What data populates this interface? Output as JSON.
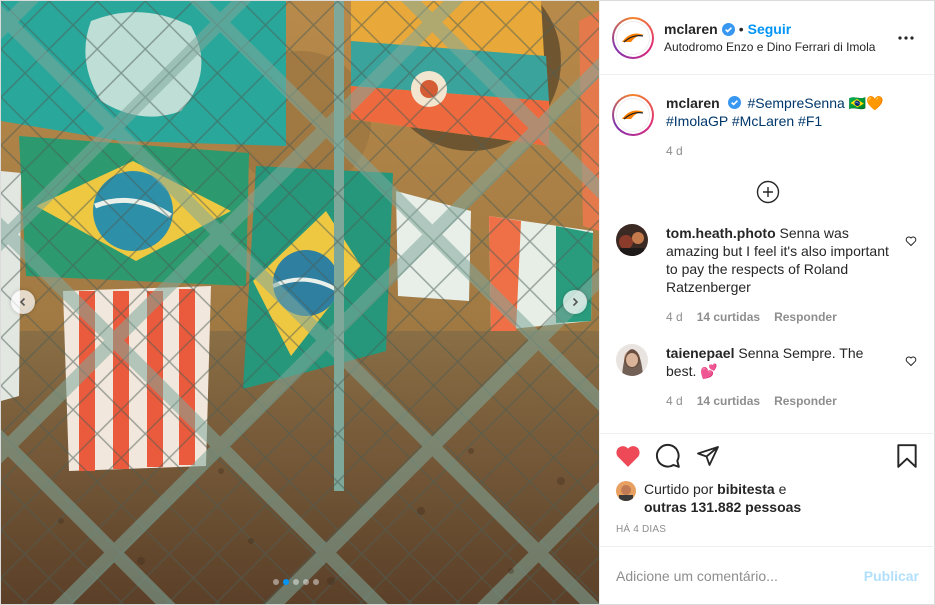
{
  "post": {
    "username": "mclaren",
    "follow_label": "Seguir",
    "separator": "•",
    "location": "Autodromo Enzo e Dino Ferrari di Imola"
  },
  "caption": {
    "username": "mclaren",
    "hashtag1": "#SempreSenna",
    "emoji": "🇧🇷🧡",
    "hashtag2": "#ImolaGP",
    "hashtag3": "#McLaren",
    "hashtag4": "#F1",
    "age": "4 d"
  },
  "comments": [
    {
      "username": "tom.heath.photo",
      "text": "Senna was amazing but I feel it's also important to pay the respects of Roland Ratzenberger",
      "age": "4 d",
      "likes": "14 curtidas",
      "reply": "Responder"
    },
    {
      "username": "taienepael",
      "text": "Senna Sempre. The best. 💕",
      "age": "4 d",
      "likes": "14 curtidas",
      "reply": "Responder"
    }
  ],
  "likes": {
    "prefix": "Curtido por",
    "user": "bibitesta",
    "and": "e",
    "others": "outras 131.882 pessoas"
  },
  "timestamp": "HÁ 4 DIAS",
  "add_comment": {
    "placeholder": "Adicione um comentário...",
    "publish_label": "Publicar"
  },
  "carousel": {
    "slide_count": 5,
    "active_slide": 2
  },
  "icons": {
    "verified": "verified-badge-icon",
    "more": "more-options-icon",
    "add_comments": "plus-circle-icon",
    "like": "heart-filled-icon",
    "comment": "comment-icon",
    "share": "share-icon",
    "save": "bookmark-icon"
  },
  "colors": {
    "accent": "#0095f6",
    "liked_heart": "#ed4956",
    "hashtag": "#00376b",
    "muted": "#8e8e8e",
    "publish_disabled": "#b2dffc"
  }
}
